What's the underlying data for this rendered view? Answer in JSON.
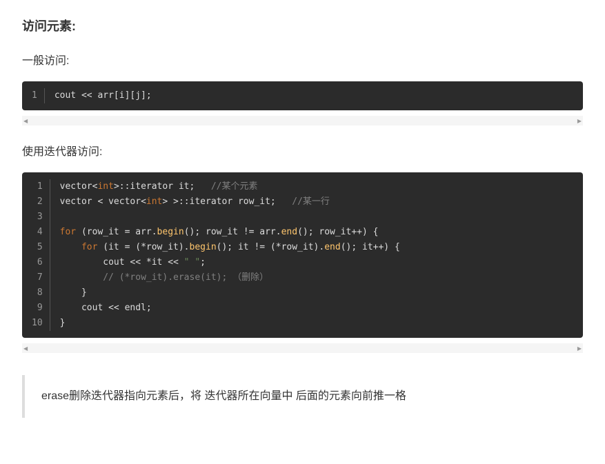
{
  "headings": {
    "access_elements": "访问元素:",
    "general_access": "一般访问:",
    "iterator_access": "使用迭代器访问:"
  },
  "code_block_1": {
    "line_numbers": [
      "1"
    ],
    "lines": [
      [
        {
          "t": "cout",
          "c": "ident"
        },
        {
          "t": " << ",
          "c": "op"
        },
        {
          "t": "arr[i][j];",
          "c": "ident"
        }
      ]
    ]
  },
  "code_block_2": {
    "line_numbers": [
      "1",
      "2",
      "3",
      "4",
      "5",
      "6",
      "7",
      "8",
      "9",
      "10"
    ],
    "lines": [
      [
        {
          "t": "vector",
          "c": "ident"
        },
        {
          "t": "<",
          "c": "punct"
        },
        {
          "t": "int",
          "c": "typekw"
        },
        {
          "t": ">",
          "c": "punct"
        },
        {
          "t": "::iterator it;   ",
          "c": "ident"
        },
        {
          "t": "//某个元素",
          "c": "cmt"
        }
      ],
      [
        {
          "t": "vector ",
          "c": "ident"
        },
        {
          "t": "<",
          "c": "punct"
        },
        {
          "t": " vector",
          "c": "ident"
        },
        {
          "t": "<",
          "c": "punct"
        },
        {
          "t": "int",
          "c": "typekw"
        },
        {
          "t": ">",
          "c": "punct"
        },
        {
          "t": " ",
          "c": "ident"
        },
        {
          "t": ">",
          "c": "punct"
        },
        {
          "t": "::iterator row_it;   ",
          "c": "ident"
        },
        {
          "t": "//某一行",
          "c": "cmt"
        }
      ],
      [],
      [
        {
          "t": "for",
          "c": "typekw"
        },
        {
          "t": " (row_it = arr.",
          "c": "ident"
        },
        {
          "t": "begin",
          "c": "fn"
        },
        {
          "t": "(); row_it != arr.",
          "c": "ident"
        },
        {
          "t": "end",
          "c": "fn"
        },
        {
          "t": "(); row_it++) {",
          "c": "ident"
        }
      ],
      [
        {
          "t": "    ",
          "c": "ident"
        },
        {
          "t": "for",
          "c": "typekw"
        },
        {
          "t": " (it = (*row_it).",
          "c": "ident"
        },
        {
          "t": "begin",
          "c": "fn"
        },
        {
          "t": "(); it != (*row_it).",
          "c": "ident"
        },
        {
          "t": "end",
          "c": "fn"
        },
        {
          "t": "(); it++) {",
          "c": "ident"
        }
      ],
      [
        {
          "t": "        cout << *it << ",
          "c": "ident"
        },
        {
          "t": "\" \"",
          "c": "str"
        },
        {
          "t": ";",
          "c": "ident"
        }
      ],
      [
        {
          "t": "        ",
          "c": "ident"
        },
        {
          "t": "// (*row_it).erase(it); （删除）",
          "c": "cmt"
        }
      ],
      [
        {
          "t": "    }",
          "c": "ident"
        }
      ],
      [
        {
          "t": "    cout << endl;",
          "c": "ident"
        }
      ],
      [
        {
          "t": "}",
          "c": "ident"
        }
      ]
    ]
  },
  "blockquote_text": "erase删除迭代器指向元素后，将 迭代器所在向量中 后面的元素向前推一格"
}
